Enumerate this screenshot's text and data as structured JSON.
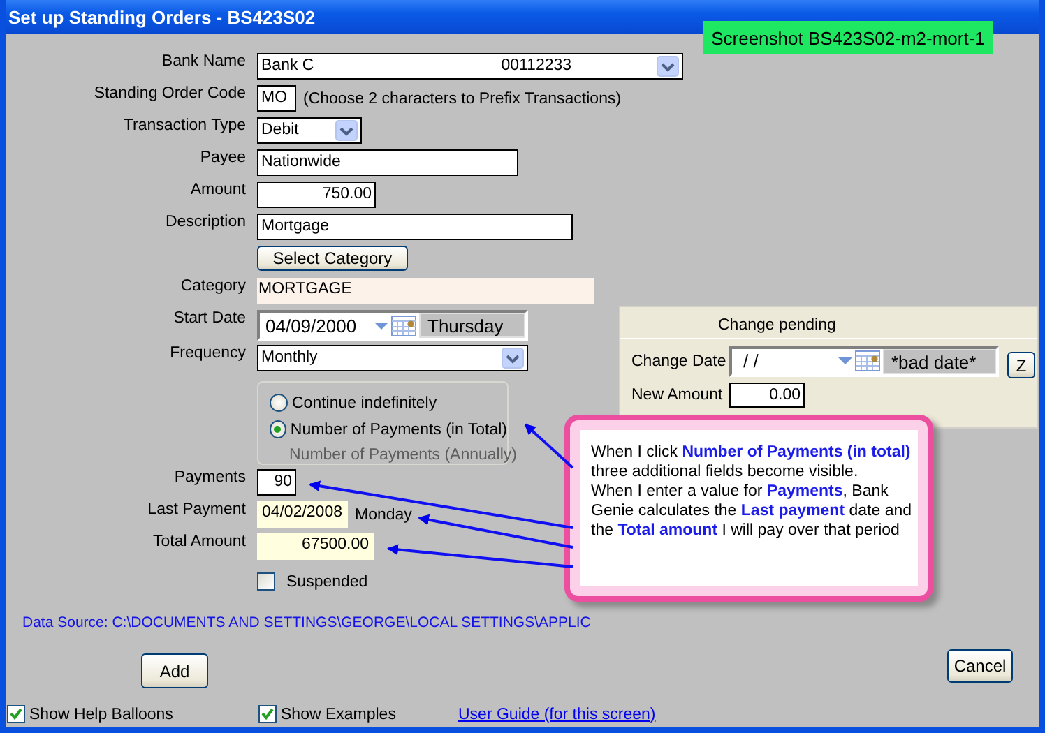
{
  "window": {
    "title": "Set up Standing Orders - BS423S02"
  },
  "screenshot_tag": "Screenshot BS423S02-m2-mort-1",
  "fields": [
    {
      "kind": "select",
      "label": "Bank Name",
      "value": "Bank C",
      "value_2": "00112233"
    },
    {
      "kind": "code",
      "label": "Standing Order Code",
      "value": "MO",
      "hint": "(Choose 2 characters to Prefix Transactions)"
    },
    {
      "kind": "select",
      "label": "Transaction Type",
      "value": "Debit"
    },
    {
      "kind": "text",
      "label": "Payee",
      "value": "Nationwide"
    },
    {
      "kind": "amount",
      "label": "Amount",
      "value": "750.00"
    },
    {
      "kind": "text",
      "label": "Description",
      "value": "Mortgage"
    },
    {
      "kind": "button",
      "label": "Select Category"
    },
    {
      "kind": "readonly",
      "label": "Category",
      "value": "MORTGAGE"
    },
    {
      "kind": "date",
      "label": "Start Date",
      "value": "04/09/2000",
      "day": "Thursday"
    },
    {
      "kind": "select",
      "label": "Frequency",
      "value": "Monthly"
    },
    {
      "kind": "radios",
      "options": [
        {
          "label": "Continue indefinitely",
          "selected": false
        },
        {
          "label": "Number of Payments (in Total)",
          "selected": true
        }
      ],
      "note": "Number of Payments (Annually)"
    },
    {
      "kind": "amount",
      "label": "Payments",
      "value": "90"
    },
    {
      "kind": "calc",
      "label": "Last Payment",
      "value": "04/02/2008",
      "day": "Monday"
    },
    {
      "kind": "calc",
      "label": "Total Amount",
      "value": "67500.00"
    },
    {
      "kind": "checkbox",
      "label": "Suspended",
      "checked": false
    }
  ],
  "data_source": "Data Source: C:\\DOCUMENTS AND SETTINGS\\GEORGE\\LOCAL SETTINGS\\APPLIC",
  "buttons": [
    "Add",
    "Cancel"
  ],
  "change_pending": {
    "title": "Change pending",
    "date_label": "Change Date",
    "date_value": "/ /",
    "date_status": "*bad date*",
    "amount_label": "New Amount",
    "amount_value": "0.00",
    "button": "Z"
  },
  "callout": {
    "paragraphs": [
      "When I click **Number of Payments (in total)** three additional fields become visible.",
      "When I enter a value for **Payments**, Bank Genie calculates the **Last payment** date and the **Total amount** I will pay over that period"
    ]
  },
  "footer": {
    "checkboxes": [
      {
        "label": "Show Help Balloons",
        "checked": true
      },
      {
        "label": "Show Examples",
        "checked": true
      }
    ],
    "link": "User Guide (for this screen)"
  }
}
